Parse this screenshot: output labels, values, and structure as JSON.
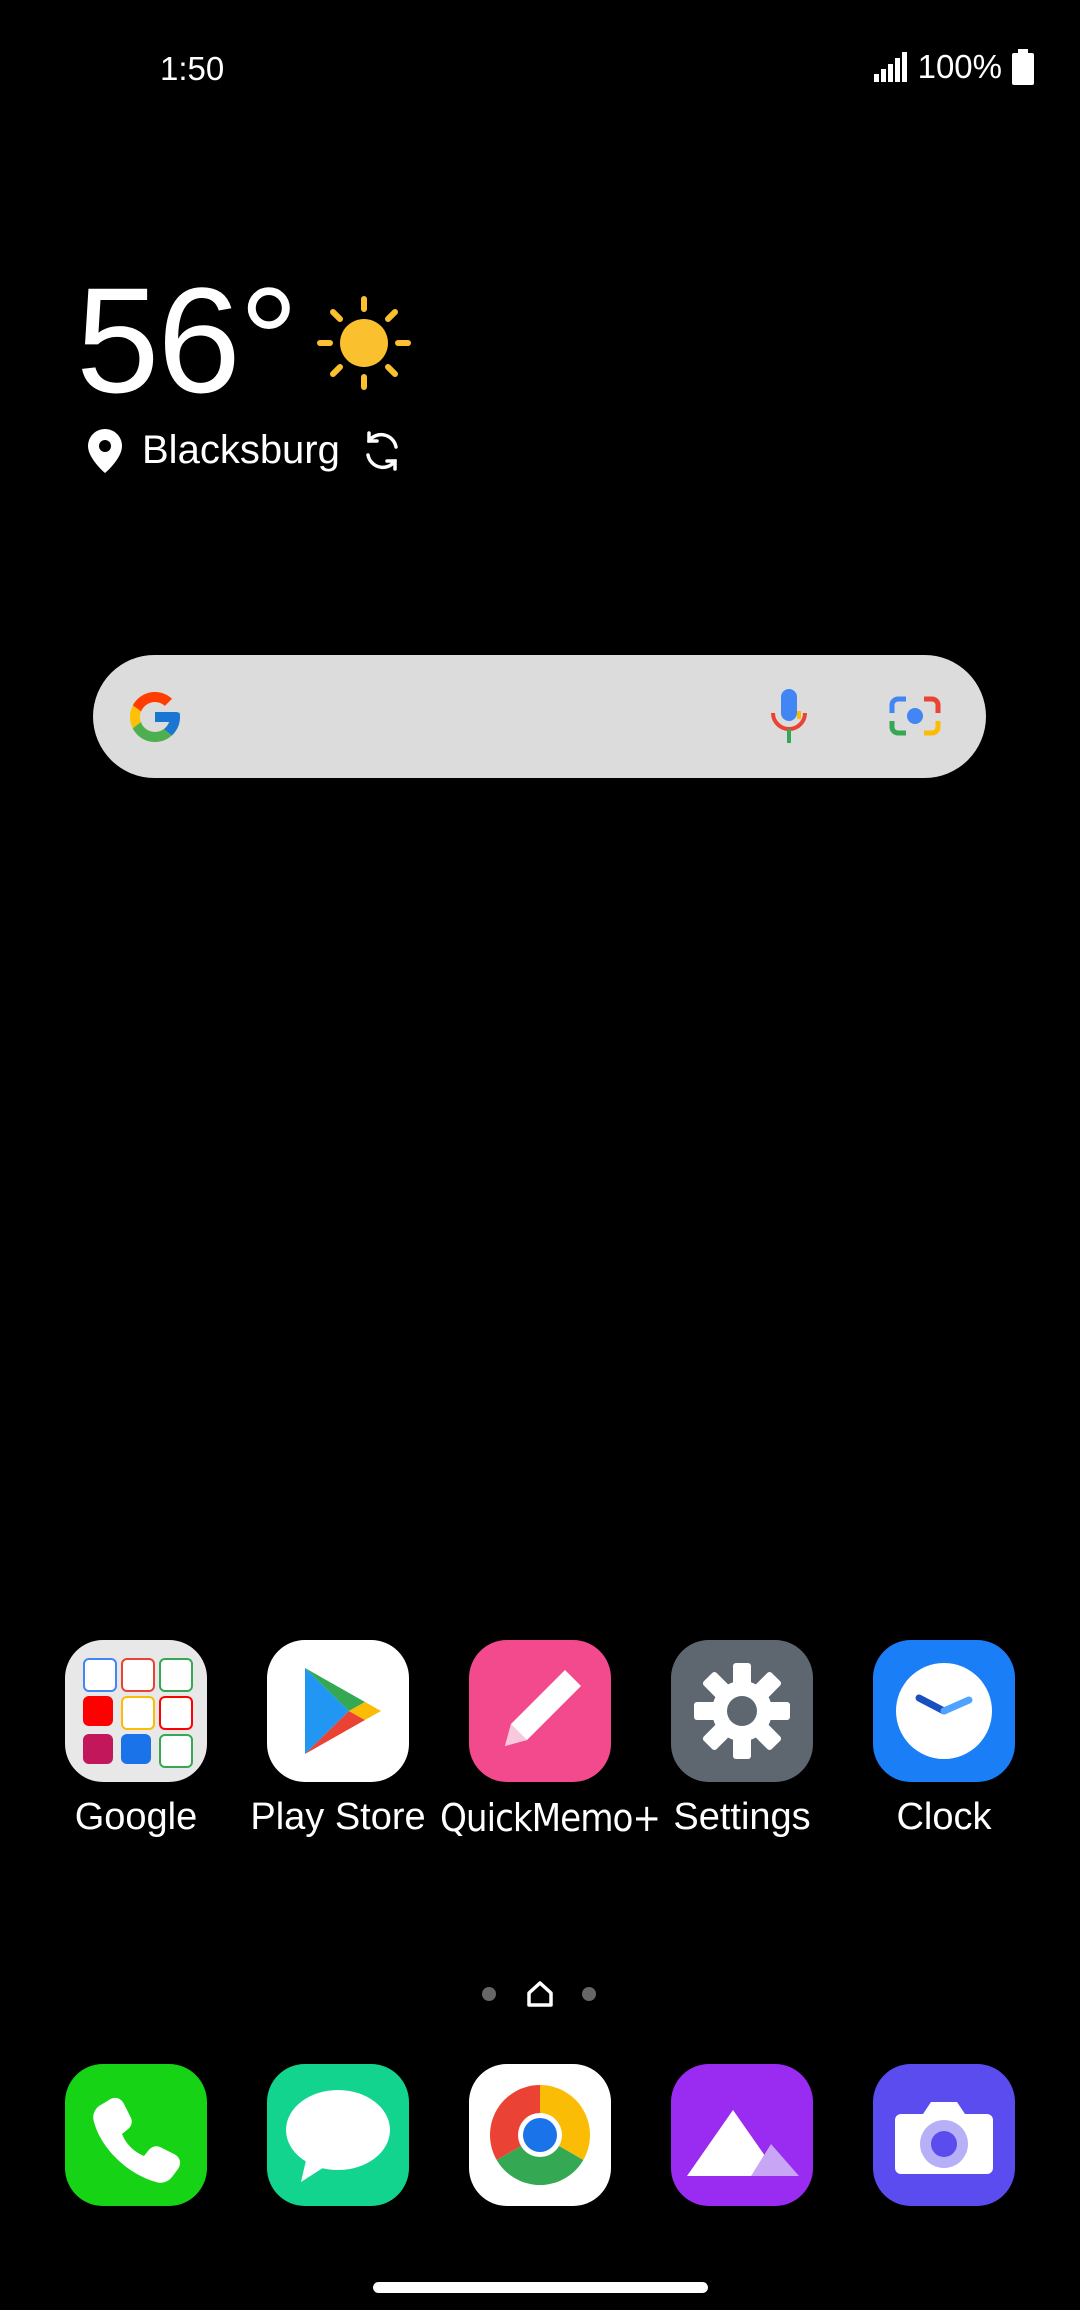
{
  "status_bar": {
    "time": "1:50",
    "battery": "100%",
    "signal_icon": "signal-bars-icon",
    "battery_icon": "battery-icon"
  },
  "weather": {
    "temperature": "56°",
    "location": "Blacksburg",
    "condition_icon": "sun-icon",
    "sun_color": "#FBC02D"
  },
  "search": {
    "logo": "google-g-icon",
    "voice_icon": "mic-icon",
    "lens_icon": "camera-lens-icon",
    "bar_color": "#dcdcdc"
  },
  "apps": [
    {
      "label": "Google",
      "icon": "google-folder-icon"
    },
    {
      "label": "Play Store",
      "icon": "play-store-icon"
    },
    {
      "label": "QuickMemo+",
      "icon": "quickmemo-pencil-icon",
      "color": "#F24A8C"
    },
    {
      "label": "Settings",
      "icon": "gear-icon",
      "color": "#5E6670"
    },
    {
      "label": "Clock",
      "icon": "clock-icon",
      "color": "#1A7EF6"
    }
  ],
  "dock": [
    {
      "icon": "phone-icon",
      "color": "#16D316"
    },
    {
      "icon": "messages-icon",
      "color": "#12D48E"
    },
    {
      "icon": "chrome-icon",
      "color": "#ffffff"
    },
    {
      "icon": "gallery-icon",
      "color": "#9A2BF0"
    },
    {
      "icon": "camera-icon",
      "color": "#5B4CF0"
    }
  ],
  "page_indicator": {
    "current": "home",
    "pages": 3
  }
}
